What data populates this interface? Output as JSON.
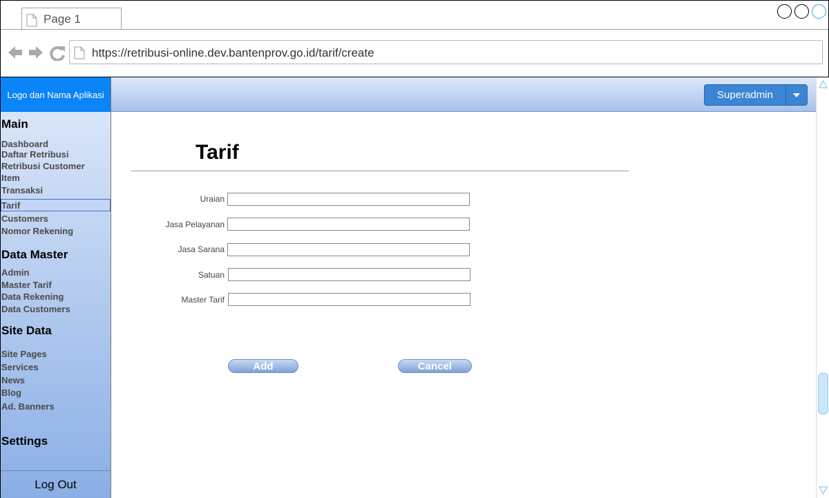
{
  "browser": {
    "tab_title": "Page 1",
    "url": "https://retribusi-online.dev.bantenprov.go.id/tarif/create"
  },
  "header": {
    "logo_text": "Logo dan Nama Aplikasi",
    "user_label": "Superadmin"
  },
  "sidebar": {
    "sections": [
      {
        "heading": "Main",
        "items": [
          "Dashboard",
          "Daftar Retribusi",
          "Retribusi Customer",
          "Item",
          "Transaksi",
          "Tarif",
          "Customers",
          "Nomor Rekening"
        ]
      },
      {
        "heading": "Data Master",
        "items": [
          "Admin",
          "Master Tarif",
          "Data Rekening",
          "Data Customers"
        ]
      },
      {
        "heading": "Site Data",
        "items": [
          "Site Pages",
          "Services",
          "News",
          "Blog",
          "Ad. Banners"
        ]
      },
      {
        "heading": "Settings",
        "items": []
      }
    ],
    "active_item": "Tarif",
    "logout_label": "Log Out"
  },
  "main": {
    "title": "Tarif",
    "fields": [
      {
        "label": "Uraian",
        "value": ""
      },
      {
        "label": "Jasa Pelayanan",
        "value": ""
      },
      {
        "label": "Jasa Sarana",
        "value": ""
      },
      {
        "label": "Satuan",
        "value": ""
      },
      {
        "label": "Master Tarif",
        "value": ""
      }
    ],
    "add_label": "Add",
    "cancel_label": "Cancel"
  },
  "colors": {
    "logo_bg": "#0a84f7",
    "user_button": "#3a85d4",
    "sidebar_top": "#d9e5f9",
    "sidebar_bottom": "#8aaee5",
    "button_gradient_bottom": "#7fa2d9"
  },
  "icons": [
    "page-icon",
    "back-arrow-icon",
    "forward-arrow-icon",
    "reload-icon",
    "document-icon",
    "caret-down-icon",
    "scroll-up-icon",
    "scroll-down-icon"
  ]
}
